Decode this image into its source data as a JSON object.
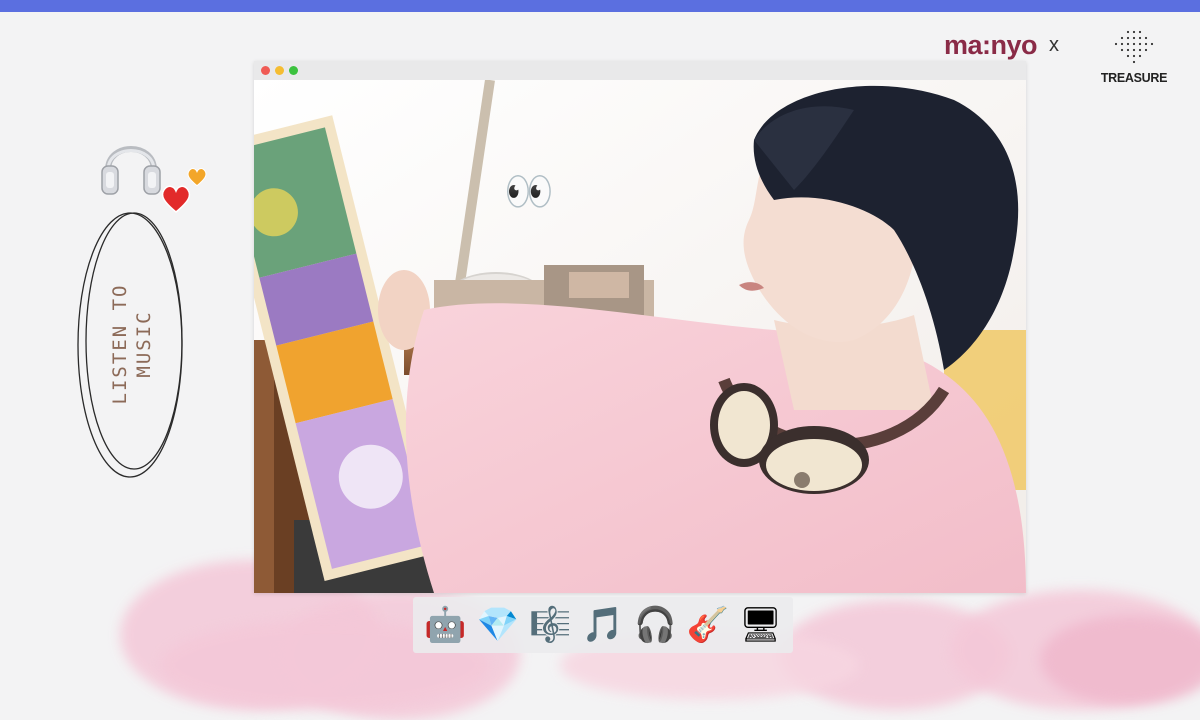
{
  "brand": {
    "left_logo": "ma:nyo",
    "separator": "x",
    "right_logo": "TREASURE"
  },
  "sidebar": {
    "label_line1": "LISTEN TO",
    "label_line2": "MUSIC",
    "icons": [
      "headphones-icon",
      "red-heart-icon",
      "orange-heart-icon"
    ]
  },
  "window": {
    "controls": [
      "close",
      "minimize",
      "maximize"
    ],
    "control_colors": {
      "close": "#f05b55",
      "minimize": "#f5bd32",
      "maximize": "#3cc23f"
    },
    "overlay_emoji": "👀"
  },
  "dock": {
    "items": [
      {
        "name": "robot",
        "glyph": "🤖"
      },
      {
        "name": "gem",
        "glyph": "💎"
      },
      {
        "name": "music-score",
        "glyph": "🎼"
      },
      {
        "name": "musical-notes",
        "glyph": "🎵"
      },
      {
        "name": "headphones",
        "glyph": "🎧"
      },
      {
        "name": "guitar",
        "glyph": "🎸"
      },
      {
        "name": "desktop-computer",
        "glyph": "🖥"
      }
    ]
  },
  "colors": {
    "accent_bar": "#5b6fe0",
    "brand": "#8a2b47",
    "sweater": "#f6c8d2",
    "clouds": "#f4c8d8"
  }
}
